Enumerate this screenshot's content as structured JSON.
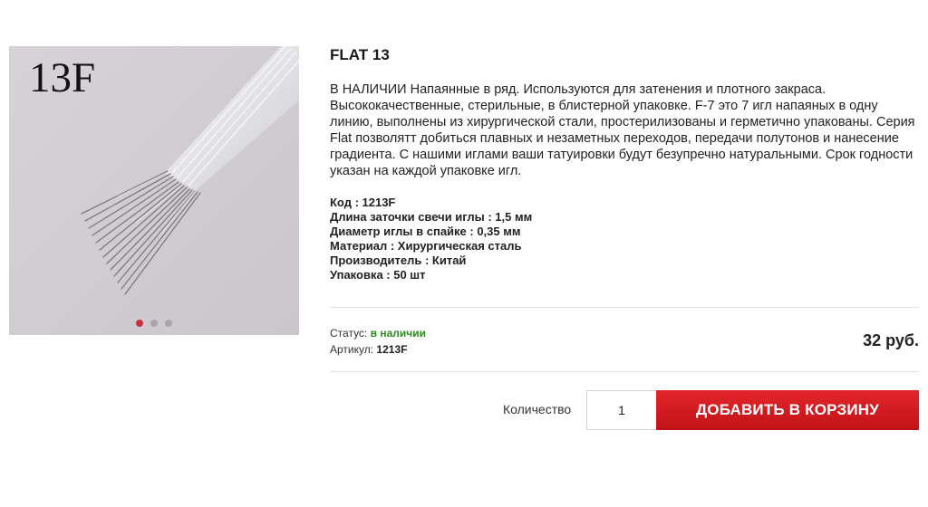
{
  "product": {
    "image_label": "13F",
    "title": "FLAT 13",
    "description": "В НАЛИЧИИ Напаянные в ряд. Используются для затенения и плотного закраса. Высококачественные, стерильные, в блистерной упаковке. F-7 это 7 игл напаяных в одну линию, выполнены из хирургической стали, простерилизованы и герметично упакованы. Серия Flat позволятт добиться плавных и незаметных переходов, передачи полутонов и нанесение градиента. С нашими иглами ваши татуировки будут безупречно натуральными. Срок годности указан на каждой упаковке игл.",
    "specs": [
      "Код : 1213F",
      "Длина заточки свечи иглы : 1,5 мм",
      "Диаметр иглы в спайке : 0,35 мм",
      "Материал : Хирургическая сталь",
      "Производитель : Китай",
      "Упаковка : 50 шт"
    ],
    "status_label": "Статус:",
    "status_value": "в наличии",
    "article_label": "Артикул:",
    "article_value": "1213F",
    "price": "32 руб.",
    "quantity_label": "Количество",
    "quantity_value": "1",
    "add_to_cart": "ДОБАВИТЬ В КОРЗИНУ"
  },
  "gallery": {
    "slide_count": 3,
    "active_slide": 1
  },
  "colors": {
    "status_green": "#2d8a1f",
    "button_red": "#d51c21",
    "dot_active": "#c8323b"
  }
}
